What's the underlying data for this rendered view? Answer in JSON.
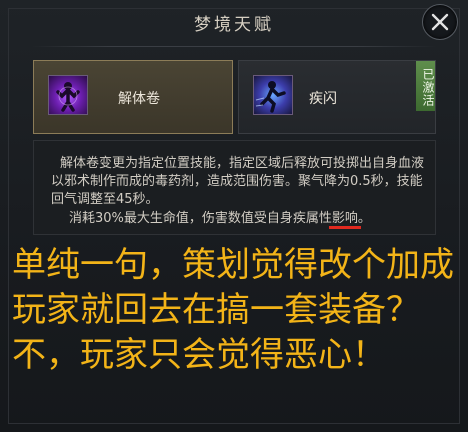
{
  "window": {
    "title": "梦境天赋"
  },
  "talents": [
    {
      "name": "解体卷",
      "icon": "purple-figure-skill-icon",
      "selected": true
    },
    {
      "name": "疾闪",
      "icon": "blue-dash-figure-skill-icon",
      "badge": "已激活"
    }
  ],
  "description": {
    "main": "解体卷变更为指定位置技能，指定区域后释放可投掷出自身血液以邪术制作而成的毒药剂，造成范围伤害。聚气降为0.5秒，技能回气调整至45秒。",
    "cost": "消耗30%最大生命值，伤害数值受自身疾属性影响。"
  },
  "comment": {
    "text": "单纯一句，策划觉得改个加成玩家就回去在搞一套装备？不，玩家只会觉得恶心！",
    "color": "#f3b418"
  },
  "colors": {
    "highlight_underline": "#e0291f",
    "selected_card": "#8c7c58",
    "active_badge": "#5f8e4c"
  }
}
